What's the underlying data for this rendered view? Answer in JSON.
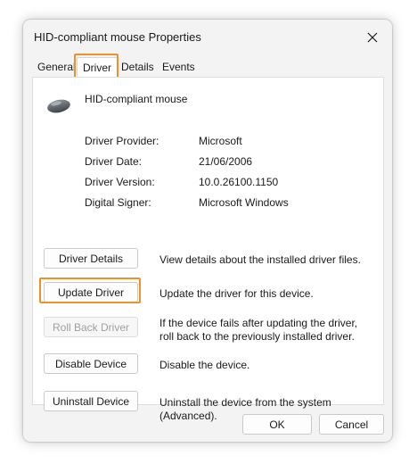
{
  "window": {
    "title": "HID-compliant mouse Properties",
    "close_icon": "close-icon"
  },
  "tabs": [
    {
      "label": "General",
      "active": false
    },
    {
      "label": "Driver",
      "active": true
    },
    {
      "label": "Details",
      "active": false
    },
    {
      "label": "Events",
      "active": false
    }
  ],
  "device": {
    "name": "HID-compliant mouse",
    "icon": "mouse-icon"
  },
  "driver_info": [
    {
      "label": "Driver Provider:",
      "value": "Microsoft"
    },
    {
      "label": "Driver Date:",
      "value": "21/06/2006"
    },
    {
      "label": "Driver Version:",
      "value": "10.0.26100.1150"
    },
    {
      "label": "Digital Signer:",
      "value": "Microsoft Windows"
    }
  ],
  "actions": [
    {
      "label": "Driver Details",
      "description": "View details about the installed driver files.",
      "enabled": true
    },
    {
      "label": "Update Driver",
      "description": "Update the driver for this device.",
      "enabled": true
    },
    {
      "label": "Roll Back Driver",
      "description": "If the device fails after updating the driver, roll back to the previously installed driver.",
      "enabled": false
    },
    {
      "label": "Disable Device",
      "description": "Disable the device.",
      "enabled": true
    },
    {
      "label": "Uninstall Device",
      "description": "Uninstall the device from the system (Advanced).",
      "enabled": true
    }
  ],
  "footer": {
    "ok_label": "OK",
    "cancel_label": "Cancel"
  },
  "colors": {
    "highlight": "#f0902a",
    "dialog_bg": "#f3f3f3",
    "panel_bg": "#ffffff"
  }
}
